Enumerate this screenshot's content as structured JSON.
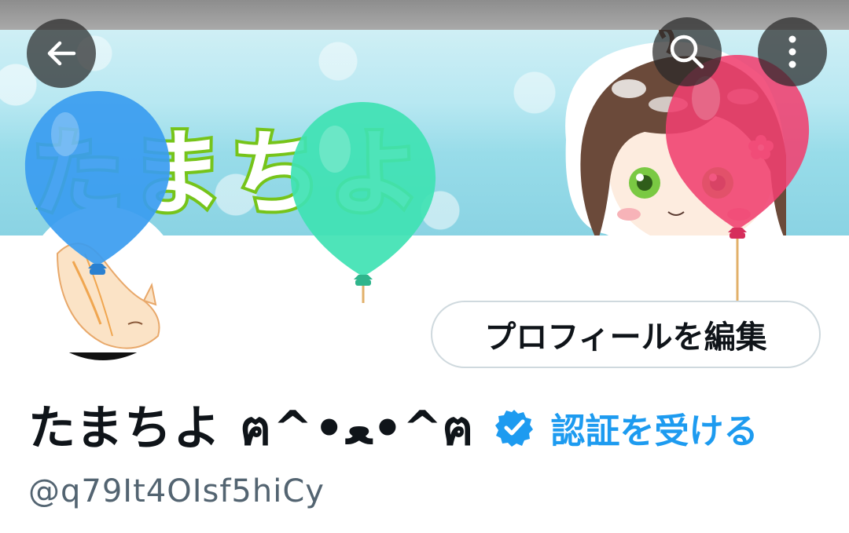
{
  "header": {
    "banner_title_chars": [
      "た",
      "ま",
      "ち",
      "よ"
    ],
    "back_icon": "arrow-left-icon",
    "search_icon": "search-icon",
    "more_icon": "more-vertical-icon"
  },
  "profile": {
    "display_name": "たまちよ ฅ^•ﻌ•^ฅ",
    "verify_link": "認証を受ける",
    "handle": "@q79It4OIsf5hiCy",
    "edit_profile_label": "プロフィールを編集"
  },
  "colors": {
    "accent": "#1d9bf0",
    "banner_green": "#76c41a",
    "banner_sky": "#98dce9",
    "balloon_blue": "#4aa3ee",
    "balloon_teal": "#3fe2b3",
    "balloon_pink": "#f0406f"
  }
}
